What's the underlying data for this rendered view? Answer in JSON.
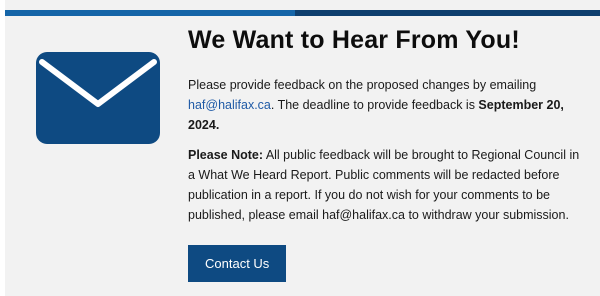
{
  "heading": "We Want to Hear From You!",
  "intro": {
    "before_link": "Please provide feedback on the proposed changes by emailing ",
    "link_text": "haf@halifax.ca",
    "after_link": ". The deadline to provide feedback is ",
    "deadline": "September 20, 2024",
    "end": "."
  },
  "note": {
    "label": "Please Note:",
    "text": " All public feedback will be brought to Regional Council in a What We Heard Report. Public comments will be redacted before publication in a report. If you do not wish for your comments to be published, please email haf@halifax.ca to withdraw your submission."
  },
  "button": {
    "label": "Contact Us"
  },
  "icons": {
    "envelope": "envelope-icon"
  },
  "colors": {
    "background": "#f2f2f2",
    "icon": "#0e4a82",
    "button": "#0e4a82",
    "link": "#1f5aa6",
    "top_rule": "#0e3f6e"
  }
}
